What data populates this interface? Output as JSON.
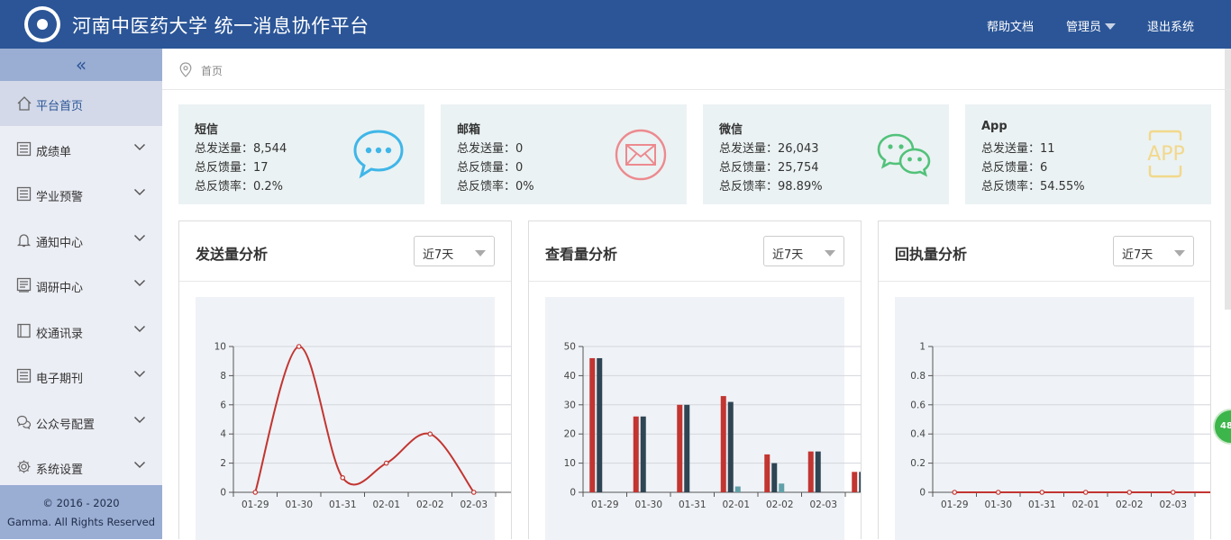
{
  "header": {
    "title": "河南中医药大学  统一消息协作平台",
    "help": "帮助文档",
    "admin": "管理员",
    "logout": "退出系统"
  },
  "sidebar": {
    "items": [
      {
        "label": "平台首页",
        "icon": "home-icon"
      },
      {
        "label": "成绩单",
        "icon": "list-icon"
      },
      {
        "label": "学业预警",
        "icon": "list-icon"
      },
      {
        "label": "通知中心",
        "icon": "bell-icon"
      },
      {
        "label": "调研中心",
        "icon": "survey-icon"
      },
      {
        "label": "校通讯录",
        "icon": "book-icon"
      },
      {
        "label": "电子期刊",
        "icon": "list-icon"
      },
      {
        "label": "公众号配置",
        "icon": "wechat-icon"
      },
      {
        "label": "系统设置",
        "icon": "gear-icon"
      }
    ],
    "footer1": "© 2016 - 2020",
    "footer2": "Gamma. All Rights Reserved"
  },
  "breadcrumb": {
    "home": "首页"
  },
  "cards": [
    {
      "title": "短信",
      "sent": "总发送量：8,544",
      "feedback": "总反馈量：17",
      "rate": "总反馈率：0.2%",
      "icon": "sms-icon",
      "color": "#3fb6e8"
    },
    {
      "title": "邮箱",
      "sent": "总发送量：0",
      "feedback": "总反馈量：0",
      "rate": "总反馈率：0%",
      "icon": "mail-icon",
      "color": "#ec8a8f"
    },
    {
      "title": "微信",
      "sent": "总发送量：26,043",
      "feedback": "总反馈量：25,754",
      "rate": "总反馈率：98.89%",
      "icon": "wechat-icon",
      "color": "#52c27a"
    },
    {
      "title": "App",
      "sent": "总发送量：11",
      "feedback": "总反馈量：6",
      "rate": "总反馈率：54.55%",
      "icon": "app-icon",
      "color": "#f2d88c"
    }
  ],
  "app_icon_text": "APP",
  "panels": [
    {
      "title": "发送量分析",
      "select": "近7天"
    },
    {
      "title": "查看量分析",
      "select": "近7天"
    },
    {
      "title": "回执量分析",
      "select": "近7天"
    }
  ],
  "badge": "48",
  "chart_data": [
    {
      "type": "line",
      "x": [
        "01-29",
        "01-30",
        "01-31",
        "02-01",
        "02-02",
        "02-03"
      ],
      "series": [
        {
          "values": [
            0,
            10,
            1,
            2,
            4,
            0
          ],
          "color": "#c23531"
        }
      ],
      "ylim": [
        0,
        10
      ],
      "yticks": [
        0,
        2,
        4,
        6,
        8,
        10
      ],
      "title": "",
      "xlabel": "",
      "ylabel": "",
      "grid": true
    },
    {
      "type": "bar",
      "categories": [
        "01-29",
        "01-30",
        "01-31",
        "02-01",
        "02-02",
        "02-03"
      ],
      "series": [
        {
          "values": [
            46,
            26,
            30,
            33,
            13,
            14,
            7
          ],
          "color": "#c23531"
        },
        {
          "values": [
            46,
            26,
            30,
            31,
            10,
            14,
            7
          ],
          "color": "#2f4554"
        },
        {
          "values": [
            0,
            0,
            0,
            2,
            3,
            0,
            0
          ],
          "color": "#61a0a8"
        }
      ],
      "ylim": [
        0,
        50
      ],
      "yticks": [
        0,
        10,
        20,
        30,
        40,
        50
      ],
      "title": "",
      "xlabel": "",
      "ylabel": "",
      "grid": true
    },
    {
      "type": "line",
      "x": [
        "01-29",
        "01-30",
        "01-31",
        "02-01",
        "02-02",
        "02-03"
      ],
      "series": [
        {
          "values": [
            0,
            0,
            0,
            0,
            0,
            0,
            0
          ],
          "color": "#c23531"
        }
      ],
      "ylim": [
        0,
        1
      ],
      "yticks": [
        0,
        0.2,
        0.4,
        0.6,
        0.8,
        1
      ],
      "title": "",
      "xlabel": "",
      "ylabel": "",
      "grid": true
    }
  ]
}
